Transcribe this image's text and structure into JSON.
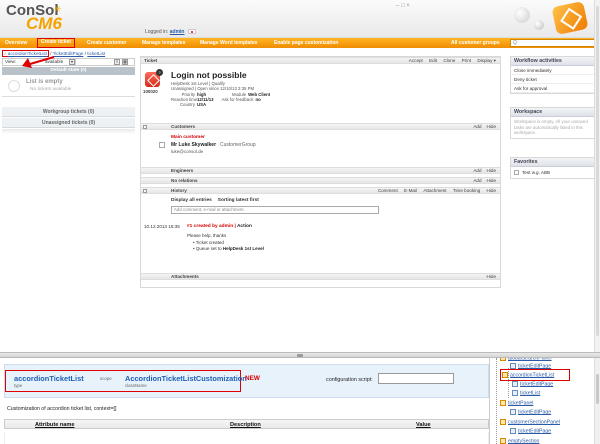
{
  "header": {
    "logo_line1": "ConSol",
    "logo_line2": "CM6",
    "logged_in_label": "Logged in:",
    "user": "admin",
    "controls": "– □ ×"
  },
  "nav": {
    "items": [
      "Overview",
      "Create ticket",
      "Create customer",
      "Manage templates",
      "Manage Word templates",
      "Enable page customization",
      "All customer groups"
    ],
    "search_placeholder": "Q"
  },
  "left": {
    "breadcrumb": [
      "accordionTicketList",
      "TicketEditPage",
      "ticketList"
    ],
    "view_label": "View:",
    "view_value": "available",
    "default_header": "Default state (0)",
    "empty_title": "List is empty",
    "empty_sub": "No tickets available",
    "workgroup": "Workgroup tickets (0)",
    "unassigned": "Unassigned tickets (0)"
  },
  "ticket": {
    "bar_label": "Ticket",
    "actions": [
      "Accept",
      "Edit",
      "Clone",
      "Print",
      "Display ▾"
    ],
    "number": "100020",
    "badge": "?",
    "title": "Login not possible",
    "meta": [
      {
        "k": "",
        "v": "HelpDesk 1st Level | Qualify"
      },
      {
        "k": "",
        "v": "Unassigned | Open since 12/10/13 3:35 PM"
      },
      {
        "k": "Priority",
        "v": "high",
        "k2": "Module",
        "v2": "Web Client"
      },
      {
        "k": "Reaction time",
        "v": "12/11/13",
        "k2": "Ask for feedback",
        "v2": "no"
      },
      {
        "k": "Country",
        "v": "USA"
      }
    ],
    "customers_label": "Customers",
    "customers_actions": [
      "Add",
      "Hide"
    ],
    "main_customer": "Main customer",
    "customer_name": "Mr Luke Skywalker",
    "customer_group": "CustomerGroup",
    "customer_email": "luke@consol.de",
    "engineers_label": "Engineers",
    "engineers_actions": [
      "Add",
      "Hide"
    ],
    "relations_label": "No relations",
    "relations_actions": [
      "Add",
      "Hide"
    ],
    "history_label": "History",
    "history_actions": [
      "Comment",
      "E-Mail",
      "Attachment",
      "Time booking",
      "Hide"
    ],
    "display_all": "Display all entries",
    "sorting": "Sorting latest first",
    "comment_placeholder": "Add comment, e-mail or attachment",
    "entry_time": "10.12.2013 15:35",
    "entry_by": "#1 created by admin |",
    "entry_action": "Action",
    "entry_text": "Please help, thanks",
    "entry_bullets": [
      "Ticket created",
      "Queue set to"
    ],
    "entry_queue": "HelpDesk 1st Level",
    "attachments_label": "Attachments",
    "attachments_actions": [
      "Hide"
    ]
  },
  "right": {
    "workflow_title": "Workflow activities",
    "workflow_items": [
      "Close immediately",
      "Deny ticket",
      "Ask for approval"
    ],
    "workspace_title": "Workspace",
    "workspace_text": "Workspace is empty. All your unsaved tasks are automatically listed in this workspace.",
    "favorites_title": "Favorites",
    "favorite_item": "Test w.g. ABB"
  },
  "inspector": {
    "id": "accordionTicketList",
    "id_type": "type",
    "scope_label": "scope",
    "class_label": "AccordionTicketListCustomization",
    "class_sub": "className",
    "new_label": "NEW",
    "config_label": "configuration script:",
    "description": "Customization of accordion ticket list, context=[]",
    "col_attr": "Attribute name",
    "col_desc": "Description",
    "col_value": "Value"
  },
  "tree": {
    "nodes": [
      "globalSearchPanel",
      "ticketEditPage",
      "accordionTicketList",
      "ticketEditPage",
      "ticketList",
      "ticketPanel",
      "ticketEditPage",
      "customerSectionPanel",
      "ticketEditPage",
      "emptySection"
    ]
  },
  "colors": {
    "accent": "#f5a200",
    "nav": "#f08c00",
    "highlight": "#dd0000",
    "link": "#2a5aa8"
  }
}
